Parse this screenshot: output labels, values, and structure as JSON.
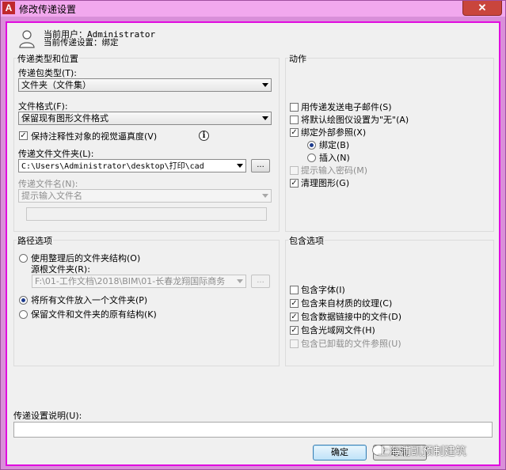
{
  "window": {
    "title": "修改传递设置",
    "close_glyph": "✕"
  },
  "user": {
    "current_user": "当前用户：Administrator",
    "current_setting": "当前传递设置：绑定"
  },
  "transmittal": {
    "group_title": "传递类型和位置",
    "package_type_label": "传递包类型(T):",
    "package_type_value": "文件夹（文件集）",
    "file_format_label": "文件格式(F):",
    "file_format_value": "保留现有图形文件格式",
    "annotative_fidelity_label": "保持注释性对象的视觉逼真度(V)",
    "annotative_fidelity_checked": true,
    "folder_label": "传递文件文件夹(L):",
    "folder_value": "C:\\Users\\Administrator\\desktop\\打印\\cad",
    "browse_label": "...",
    "file_name_label": "传递文件名(N):",
    "file_name_value": "提示输入文件名"
  },
  "path_options": {
    "group_title": "路径选项",
    "organized_label": "使用整理后的文件夹结构(O)",
    "source_root_label": "源根文件夹(R):",
    "source_root_value": "F:\\01-工作文档\\2018\\BIM\\01-长春龙翔国际商务",
    "browse_label": "...",
    "single_folder_label": "将所有文件放入一个文件夹(P)",
    "keep_structure_label": "保留文件和文件夹的原有结构(K)",
    "selected": "single_folder"
  },
  "actions": {
    "group_title": "动作",
    "send_email_label": "用传递发送电子邮件(S)",
    "send_email_checked": false,
    "default_plotter_label": "将默认绘图仪设置为\"无\"(A)",
    "default_plotter_checked": false,
    "bind_xrefs_label": "绑定外部参照(X)",
    "bind_xrefs_checked": true,
    "bind_label": "绑定(B)",
    "insert_label": "插入(N)",
    "bind_mode": "bind",
    "prompt_password_label": "提示输入密码(M)",
    "prompt_password_checked": false,
    "purge_label": "清理图形(G)",
    "purge_checked": true
  },
  "include": {
    "group_title": "包含选项",
    "fonts_label": "包含字体(I)",
    "fonts_checked": false,
    "material_textures_label": "包含来自材质的纹理(C)",
    "material_textures_checked": true,
    "data_links_label": "包含数据链接中的文件(D)",
    "data_links_checked": true,
    "photometric_label": "包含光域网文件(H)",
    "photometric_checked": true,
    "unloaded_xrefs_label": "包含已卸载的文件参照(U)",
    "unloaded_xrefs_checked": false
  },
  "description": {
    "label": "传递设置说明(U):",
    "value": ""
  },
  "buttons": {
    "ok_label": "确定",
    "cancel_label": "取消"
  },
  "watermark": {
    "text": "上海浦凯预制建筑"
  }
}
